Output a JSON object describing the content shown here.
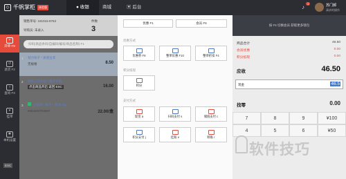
{
  "app": {
    "logo_text": "千帆掌柜",
    "version_badge": "体验版"
  },
  "topnav": {
    "tabs": [
      {
        "label": "收银"
      },
      {
        "label": "商城"
      },
      {
        "label": "后台"
      }
    ]
  },
  "user": {
    "notif_count": "1",
    "name": "苏门郝",
    "sub": "请求的操作"
  },
  "sidebar": {
    "items": [
      {
        "label": "开单 F9"
      },
      {
        "label": "退货 F2"
      },
      {
        "label": "查询 F3"
      },
      {
        "label": "挂单"
      },
      {
        "label": "本机设置"
      }
    ],
    "esc_label": "ESC"
  },
  "order": {
    "line1": "销售单号: 181015-8763",
    "line2": "导购员: 未录入",
    "count_label": "件数",
    "count": "3",
    "search_placeholder": "扫码(商品条码/自编码/编号/商品名称) F1",
    "rows": [
      {
        "idx": "1",
        "name": "韧力钩子 * 质感豆浆",
        "sub": "无规格",
        "price": "8.50"
      },
      {
        "idx": "2",
        "name": "纳米工作计划 * 椰子牛奶",
        "tag": "点击商品开启 返回 ESC",
        "price": "16.00"
      },
      {
        "idx": "3",
        "name": "小蛋糕 - 椰子 * 奶油 20g",
        "sub": "6954200704937",
        "price": "22.00/盒"
      }
    ]
  },
  "pay": {
    "tabs": {
      "left": "优惠 F1",
      "right": "会员 F6"
    },
    "section1": "优惠方式",
    "discounts": [
      {
        "label": "优惠券 F8"
      },
      {
        "label": "整单优惠 F10"
      },
      {
        "label": "整单折扣 F4"
      }
    ],
    "section2": "积分抵现",
    "points": {
      "label": "积分"
    },
    "section3": "支付方式",
    "methods": [
      {
        "label": "现金 a"
      },
      {
        "label": "扫码支付 s"
      },
      {
        "label": "储值支付 c"
      },
      {
        "label": "积分支付 j"
      },
      {
        "label": "挂账 e"
      },
      {
        "label": "赊账 r"
      }
    ]
  },
  "settle": {
    "hint": "按 F6 切换会员 获取更多钱包",
    "rows": [
      {
        "label": "商品合计",
        "value": "46.50"
      },
      {
        "label": "会员优惠",
        "value": "0.00"
      },
      {
        "label": "积分抵现",
        "value": "0.00"
      }
    ],
    "due_label": "应收",
    "due_value": "46.50",
    "cash_label": "现金",
    "cash_value": "46.5",
    "change_label": "找零",
    "change_value": "0.00",
    "keys": [
      "7",
      "8",
      "9",
      "¥100",
      "4",
      "5",
      "6",
      "¥50"
    ]
  },
  "watermark": "软件技巧",
  "colors": {
    "accent": "#e64a3b",
    "blue": "#3d7bd9"
  }
}
